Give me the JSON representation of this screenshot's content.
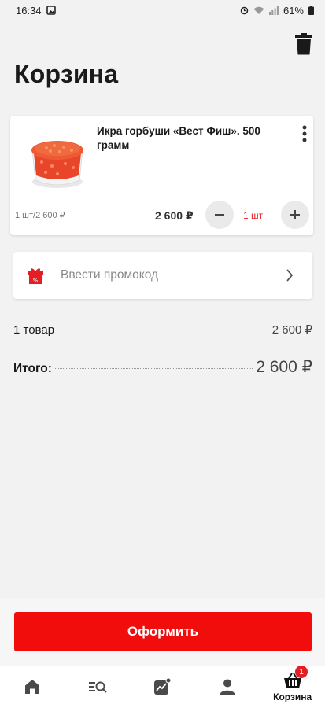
{
  "status_bar": {
    "time": "16:34",
    "battery": "61%"
  },
  "header": {
    "title": "Корзина"
  },
  "cart_item": {
    "name": "Икра горбуши «Вест Фиш». 500 грамм",
    "unit_price": "1 шт/2 600 ₽",
    "line_price": "2 600 ₽",
    "quantity": "1 шт"
  },
  "promo": {
    "label": "Ввести промокод"
  },
  "summary": {
    "items_label": "1 товар",
    "items_value": "2 600 ₽",
    "total_label": "Итого:",
    "total_value": "2 600 ₽"
  },
  "checkout": {
    "label": "Оформить"
  },
  "bottom_nav": {
    "active_label": "Корзина",
    "cart_badge": "1",
    "icons": [
      "home-icon",
      "search-catalog-icon",
      "promo-chart-icon",
      "profile-icon",
      "cart-basket-icon"
    ]
  },
  "colors": {
    "accent": "#f20d0d",
    "badge": "#e31e24",
    "background": "#f2f2f2"
  }
}
